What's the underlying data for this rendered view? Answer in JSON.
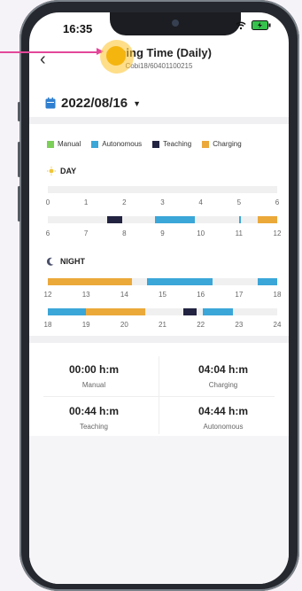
{
  "status": {
    "time": "16:35"
  },
  "header": {
    "title": "eaning Time (Daily)",
    "subtitle": "Cobi18/60401100215"
  },
  "date": {
    "value": "2022/08/16"
  },
  "legend": [
    {
      "label": "Manual",
      "color": "#7ccf59"
    },
    {
      "label": "Autonomous",
      "color": "#3ba6d8"
    },
    {
      "label": "Teaching",
      "color": "#222341"
    },
    {
      "label": "Charging",
      "color": "#eba93a"
    }
  ],
  "day": {
    "title": "DAY",
    "row1_ticks": [
      "0",
      "1",
      "2",
      "3",
      "4",
      "5",
      "6"
    ],
    "row2_ticks": [
      "6",
      "7",
      "8",
      "9",
      "10",
      "11",
      "12"
    ],
    "row2_segments": [
      {
        "type": "Teaching",
        "start": 7.55,
        "end": 7.95
      },
      {
        "type": "Autonomous",
        "start": 8.8,
        "end": 9.85
      },
      {
        "type": "Autonomous",
        "start": 11.0,
        "end": 11.05
      },
      {
        "type": "Charging",
        "start": 11.5,
        "end": 12.0
      }
    ]
  },
  "night": {
    "title": "NIGHT",
    "row1_ticks": [
      "12",
      "13",
      "14",
      "15",
      "16",
      "17",
      "18"
    ],
    "row2_ticks": [
      "18",
      "19",
      "20",
      "21",
      "22",
      "23",
      "24"
    ],
    "row1_segments": [
      {
        "type": "Charging",
        "start": 12.0,
        "end": 14.2
      },
      {
        "type": "Autonomous",
        "start": 14.6,
        "end": 16.3
      },
      {
        "type": "Autonomous",
        "start": 17.5,
        "end": 18.0
      }
    ],
    "row2_segments": [
      {
        "type": "Autonomous",
        "start": 18.0,
        "end": 19.0
      },
      {
        "type": "Charging",
        "start": 19.0,
        "end": 20.55
      },
      {
        "type": "Teaching",
        "start": 21.55,
        "end": 21.9
      },
      {
        "type": "Autonomous",
        "start": 22.05,
        "end": 22.85
      }
    ]
  },
  "summary": {
    "manual_value": "00:00 h:m",
    "manual_label": "Manual",
    "charging_value": "04:04 h:m",
    "charging_label": "Charging",
    "teaching_value": "00:44 h:m",
    "teaching_label": "Teaching",
    "autonomous_value": "04:44 h:m",
    "autonomous_label": "Autonomous"
  }
}
